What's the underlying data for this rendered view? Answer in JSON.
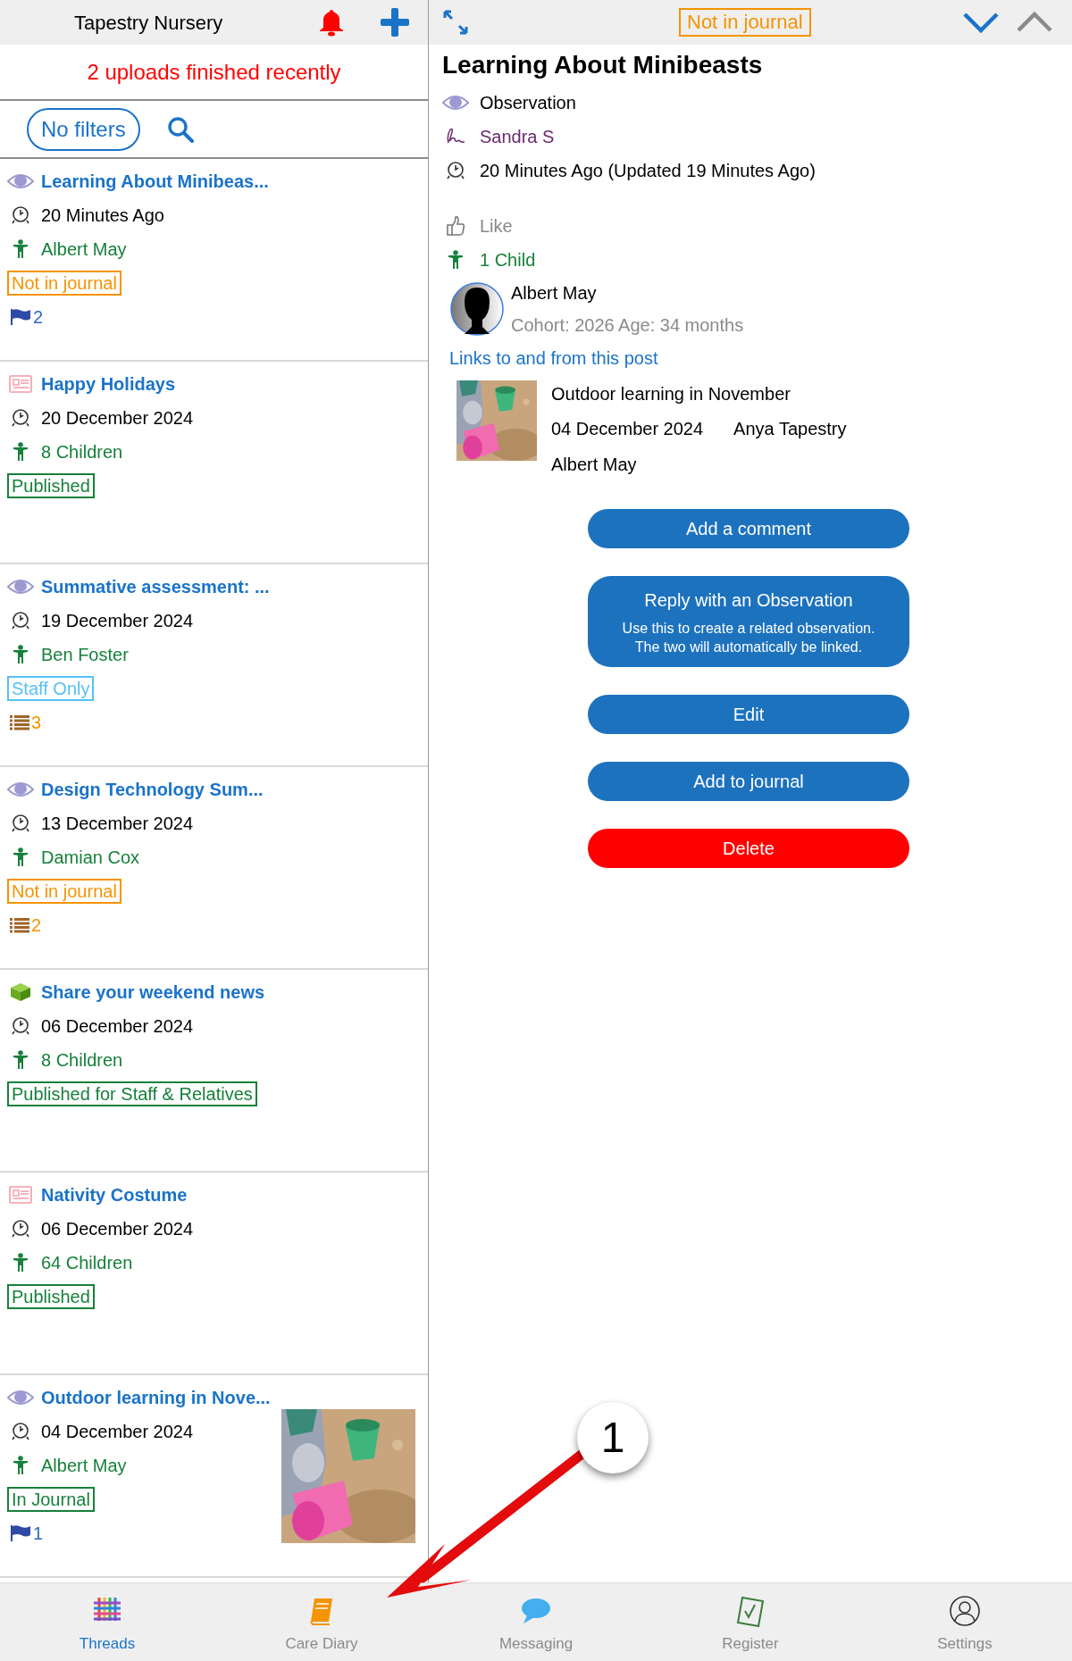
{
  "header": {
    "title": "Tapestry Nursery"
  },
  "upload_notice": "2 uploads finished recently",
  "filter_button": "No filters",
  "posts": [
    {
      "kind": "observation",
      "title": "Learning About Minibeas...",
      "date": "20 Minutes Ago",
      "children": "Albert May",
      "tag": {
        "text": "Not in journal",
        "color": "#f59300"
      },
      "count": {
        "kind": "flag",
        "text": "2"
      },
      "has_picture": false
    },
    {
      "kind": "memo",
      "title": "Happy Holidays",
      "date": "20 December 2024",
      "children": "8 Children",
      "tag": {
        "text": "Published",
        "color": "#16813a"
      },
      "has_picture": false
    },
    {
      "kind": "observation",
      "title": "Summative assessment: ...",
      "date": "19 December 2024",
      "children": "Ben Foster",
      "tag": {
        "text": "Staff Only",
        "color": "#55c1f5"
      },
      "count": {
        "kind": "list",
        "text": "3"
      },
      "has_picture": false
    },
    {
      "kind": "observation",
      "title": "Design Technology Sum...",
      "date": "13 December 2024",
      "children": "Damian Cox",
      "tag": {
        "text": "Not in journal",
        "color": "#f59300"
      },
      "count": {
        "kind": "list",
        "text": "2"
      },
      "has_picture": false
    },
    {
      "kind": "share",
      "title": "Share your weekend news",
      "date": "06 December 2024",
      "children": "8 Children",
      "tag": {
        "text": "Published for Staff & Relatives",
        "color": "#16813a"
      },
      "has_picture": false
    },
    {
      "kind": "memo",
      "title": "Nativity Costume",
      "date": "06 December 2024",
      "children": "64 Children",
      "tag": {
        "text": "Published",
        "color": "#16813a"
      },
      "has_picture": false
    },
    {
      "kind": "observation",
      "title": "Outdoor learning in Nove...",
      "date": "04 December 2024",
      "children": "Albert May",
      "tag": {
        "text": "In Journal",
        "color": "#16813a"
      },
      "count": {
        "kind": "flag",
        "text": "1"
      },
      "has_picture": true
    }
  ],
  "detail": {
    "status_tag": "Not in journal",
    "title": "Learning About Minibeasts",
    "type": "Observation",
    "author": "Sandra S",
    "time": "20 Minutes Ago (Updated 19 Minutes Ago)",
    "like": "Like",
    "children_count": "1 Child",
    "child": {
      "name": "Albert May",
      "info": "Cohort: 2026 Age: 34 months"
    },
    "links_heading": "Links to and from this post",
    "link": {
      "title": "Outdoor learning in November",
      "date": "04 December 2024",
      "author": "Anya Tapestry",
      "child": "Albert May"
    },
    "buttons": [
      {
        "kind": "primary",
        "label": "Add a comment"
      },
      {
        "kind": "primary",
        "label": "Reply with an Observation",
        "note": "Use this to create a related observation. The two will automatically be linked."
      },
      {
        "kind": "primary",
        "label": "Edit"
      },
      {
        "kind": "primary",
        "label": "Add to journal"
      },
      {
        "kind": "danger",
        "label": "Delete"
      }
    ]
  },
  "nav": [
    {
      "kind": "threads",
      "label": "Threads",
      "selected": true
    },
    {
      "kind": "diary",
      "label": "Care Diary",
      "selected": false
    },
    {
      "kind": "messaging",
      "label": "Messaging",
      "selected": false
    },
    {
      "kind": "register",
      "label": "Register",
      "selected": false
    },
    {
      "kind": "settings",
      "label": "Settings",
      "selected": false
    }
  ],
  "annotation": {
    "number": "1"
  }
}
